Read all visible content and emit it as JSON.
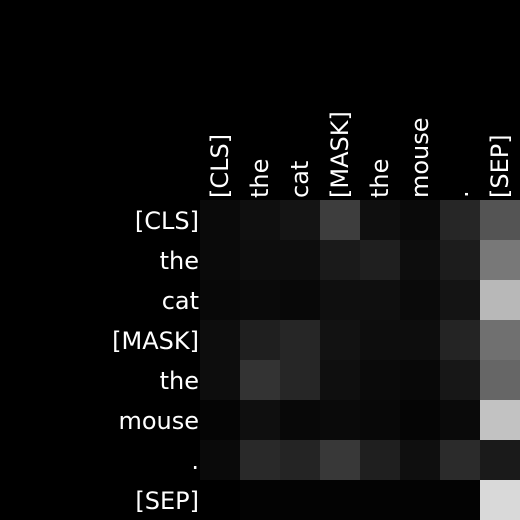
{
  "chart_data": {
    "type": "heatmap",
    "title": "",
    "xlabel": "",
    "ylabel": "",
    "x_tokens": [
      "[CLS]",
      "the",
      "cat",
      "[MASK]",
      "the",
      "mouse",
      ".",
      "[SEP]"
    ],
    "y_tokens": [
      "[CLS]",
      "the",
      "cat",
      "[MASK]",
      "the",
      "mouse",
      ".",
      "[SEP]"
    ],
    "colormap": "grayscale",
    "value_range": [
      0,
      1
    ],
    "values": [
      [
        0.04,
        0.06,
        0.08,
        0.24,
        0.06,
        0.04,
        0.15,
        0.33
      ],
      [
        0.04,
        0.05,
        0.05,
        0.1,
        0.12,
        0.05,
        0.11,
        0.47
      ],
      [
        0.03,
        0.04,
        0.03,
        0.06,
        0.06,
        0.04,
        0.08,
        0.72
      ],
      [
        0.05,
        0.12,
        0.15,
        0.07,
        0.05,
        0.05,
        0.14,
        0.44
      ],
      [
        0.05,
        0.2,
        0.15,
        0.06,
        0.04,
        0.03,
        0.09,
        0.4
      ],
      [
        0.02,
        0.06,
        0.03,
        0.04,
        0.03,
        0.02,
        0.04,
        0.76
      ],
      [
        0.04,
        0.16,
        0.14,
        0.22,
        0.12,
        0.06,
        0.17,
        0.1
      ],
      [
        0.0,
        0.01,
        0.01,
        0.01,
        0.01,
        0.01,
        0.01,
        0.85
      ]
    ],
    "background_color": "#000000",
    "label_color": "#ffffff"
  }
}
